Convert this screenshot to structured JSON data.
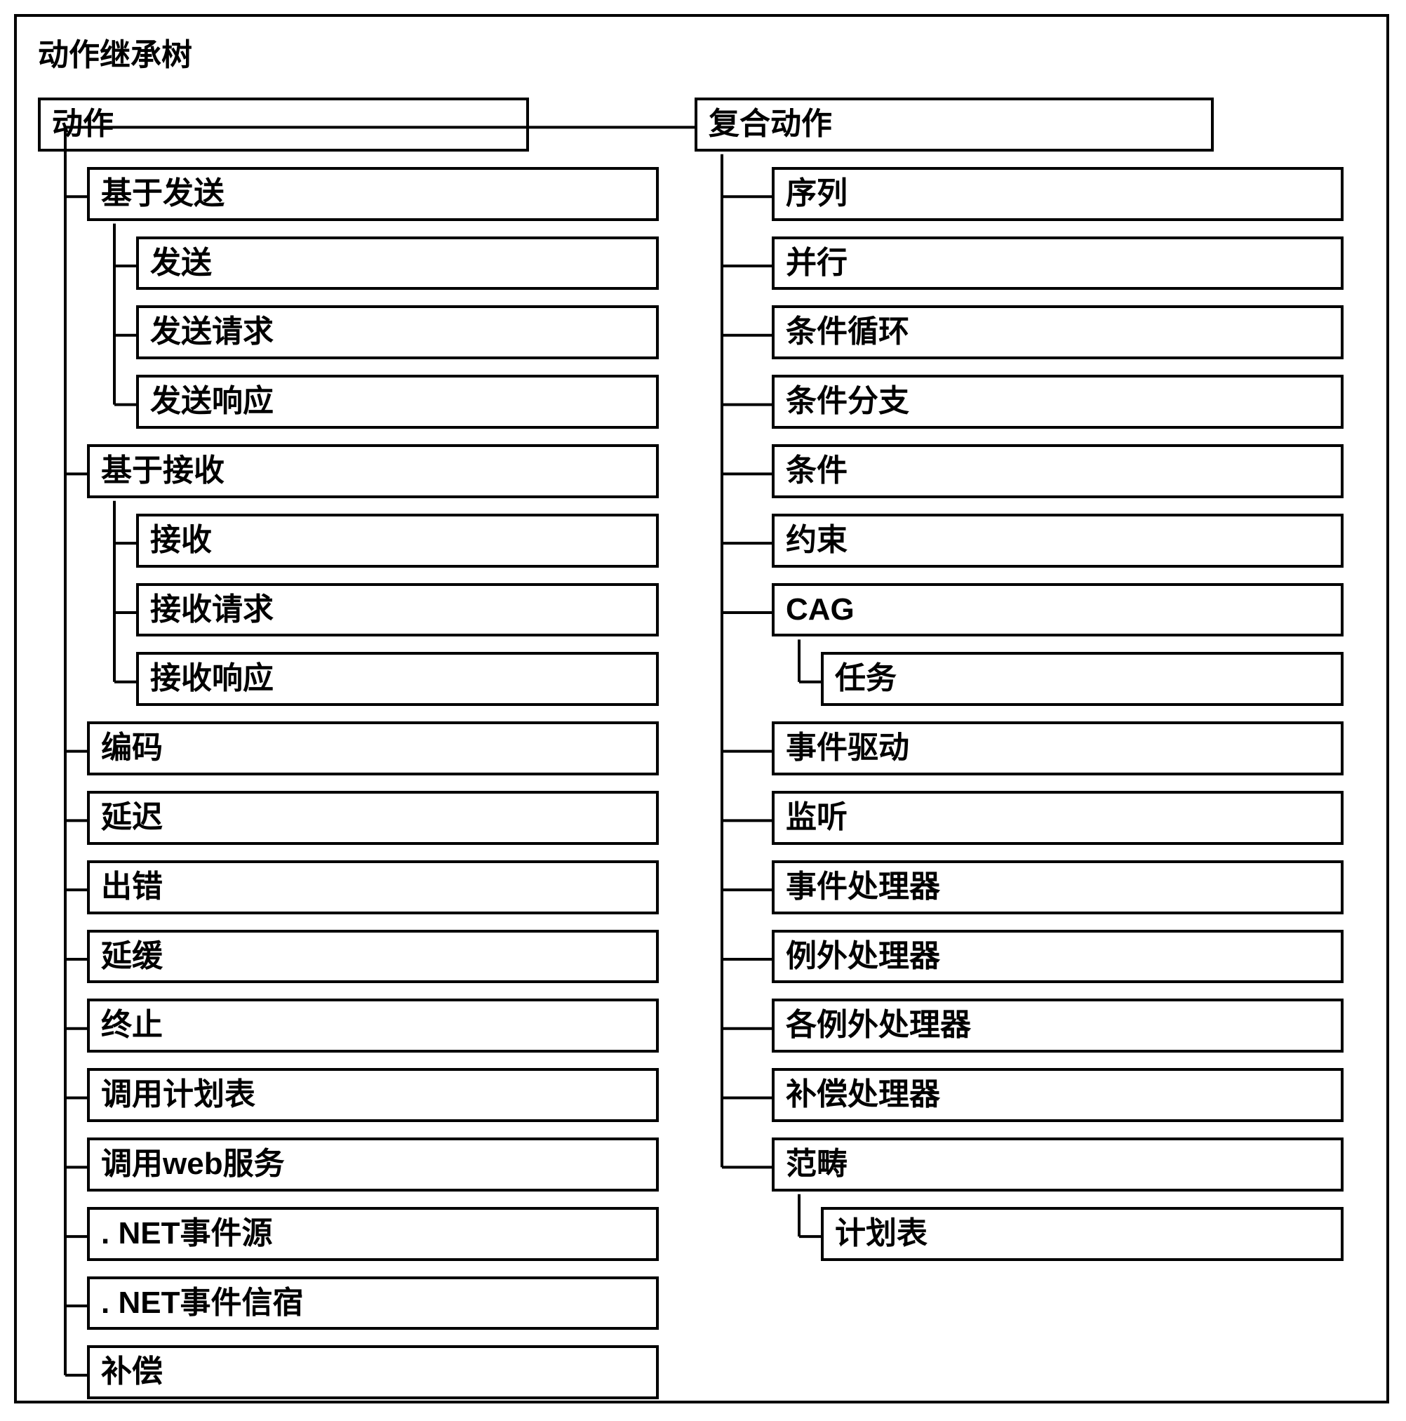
{
  "title": "动作继承树",
  "left": {
    "root": "动作",
    "items": [
      {
        "label": "基于发送",
        "children": [
          "发送",
          "发送请求",
          "发送响应"
        ]
      },
      {
        "label": "基于接收",
        "children": [
          "接收",
          "接收请求",
          "接收响应"
        ]
      },
      {
        "label": "编码"
      },
      {
        "label": "延迟"
      },
      {
        "label": "出错"
      },
      {
        "label": "延缓"
      },
      {
        "label": "终止"
      },
      {
        "label": "调用计划表"
      },
      {
        "label": "调用web服务"
      },
      {
        "label": ". NET事件源"
      },
      {
        "label": ". NET事件信宿"
      },
      {
        "label": "补偿"
      }
    ]
  },
  "right": {
    "root": "复合动作",
    "items": [
      {
        "label": "序列"
      },
      {
        "label": "并行"
      },
      {
        "label": "条件循环"
      },
      {
        "label": "条件分支"
      },
      {
        "label": "条件"
      },
      {
        "label": "约束"
      },
      {
        "label": "CAG",
        "children": [
          "任务"
        ]
      },
      {
        "label": "事件驱动"
      },
      {
        "label": "监听"
      },
      {
        "label": "事件处理器"
      },
      {
        "label": "例外处理器"
      },
      {
        "label": "各例外处理器"
      },
      {
        "label": "补偿处理器"
      },
      {
        "label": "范畴",
        "children": [
          "计划表"
        ]
      }
    ]
  }
}
